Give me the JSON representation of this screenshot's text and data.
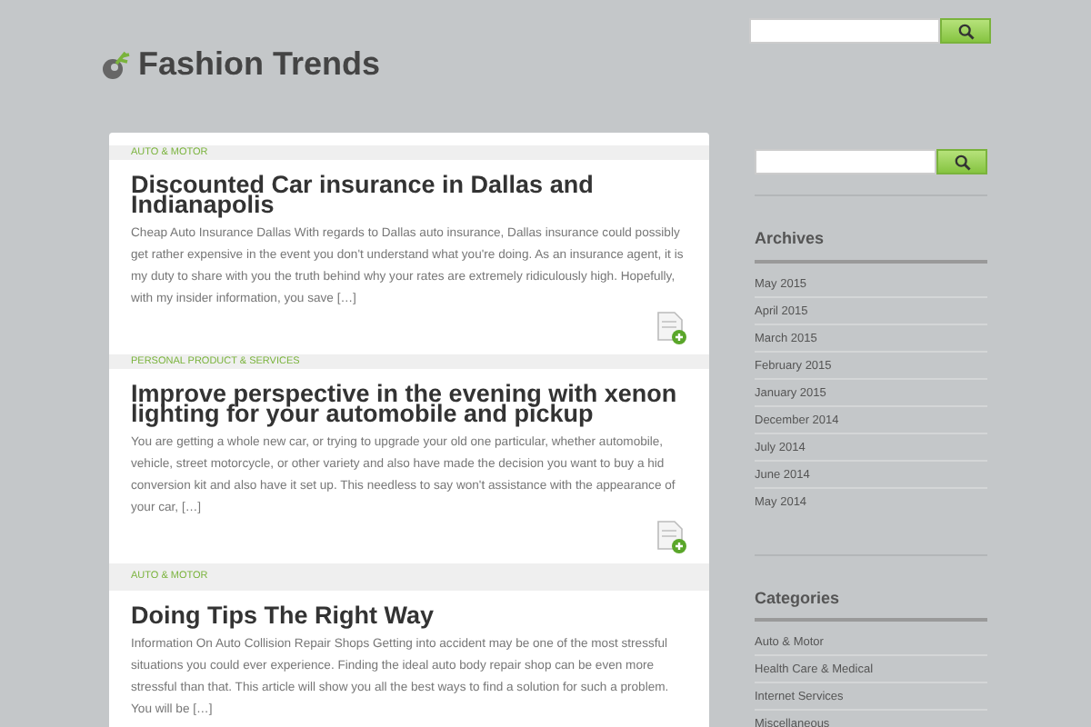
{
  "site": {
    "title": "Fashion Trends"
  },
  "posts": [
    {
      "category": "AUTO & MOTOR",
      "title": "Discounted Car insurance in Dallas and Indianapolis",
      "excerpt": "Cheap Auto Insurance Dallas With regards to Dallas auto insurance,  Dallas insurance could possibly get rather expensive in the event you don't understand what  you're doing.  As an insurance agent, it is my duty to share with you the truth behind why your rates are extremely ridiculously high.  Hopefully, with my insider information, you save […]"
    },
    {
      "category": "PERSONAL PRODUCT & SERVICES",
      "title": "Improve perspective in the evening with xenon lighting for your automobile and pickup",
      "excerpt": "You are getting a whole new car, or trying to upgrade your old one particular, whether automobile, vehicle, street motorcycle, or other variety and also have made the decision you want to buy a hid conversion kit and also have it set up. This needless to say won't assistance with the appearance of your car, […]"
    },
    {
      "category": "AUTO & MOTOR",
      "title": "Doing Tips The Right Way",
      "excerpt": "Information On Auto Collision Repair Shops Getting into accident may be one of the most stressful situations you could ever experience. Finding the ideal auto body repair shop can be even more stressful than that. This article will show you all the best ways to find a solution for such a problem. You will be […]"
    }
  ],
  "sidebar": {
    "widgets": [
      {
        "title": "Archives",
        "items": [
          "May 2015",
          "April 2015",
          "March 2015",
          "February 2015",
          "January 2015",
          "December 2014",
          "July 2014",
          "June 2014",
          "May 2014"
        ]
      },
      {
        "title": "Categories",
        "items": [
          "Auto & Motor",
          "Health Care & Medical",
          "Internet Services",
          "Miscellaneous"
        ]
      }
    ]
  }
}
